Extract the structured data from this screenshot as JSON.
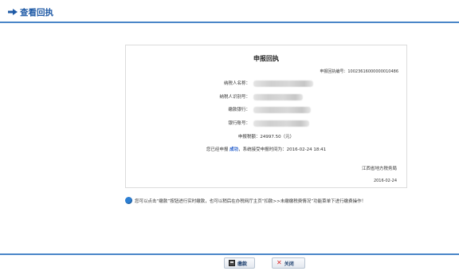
{
  "header": {
    "title": "查看回执",
    "accent_color": "#1f5aa6",
    "icon": "arrow-right-icon"
  },
  "receipt": {
    "title": "申报回执",
    "receipt_no_label": "申报回执编号：",
    "receipt_no": "10023616000000010486",
    "fields": [
      {
        "label": "纳税人名称："
      },
      {
        "label": "纳税人识别号："
      },
      {
        "label": "缴款银行："
      },
      {
        "label": "银行账号："
      }
    ],
    "tax_label": "申报税额：",
    "tax_amount": "24997.50（元）",
    "status_prefix": "您已经申报",
    "status_value": "成功",
    "status_suffix": "，系统接受申报时间为：",
    "accept_time": "2016-02-24 18:41",
    "bureau": "江西省地方税务局",
    "date": "2016-02-24"
  },
  "notice": {
    "text": "您可以点击“缴款”按钮进行实时缴款，也可以稍后在办税网厅主页“扣款>>未缴缴税费情况”功能菜单下进行缴费操作！",
    "icon": "info-icon"
  },
  "buttons": {
    "pay_label": "缴款",
    "close_label": "关闭"
  }
}
